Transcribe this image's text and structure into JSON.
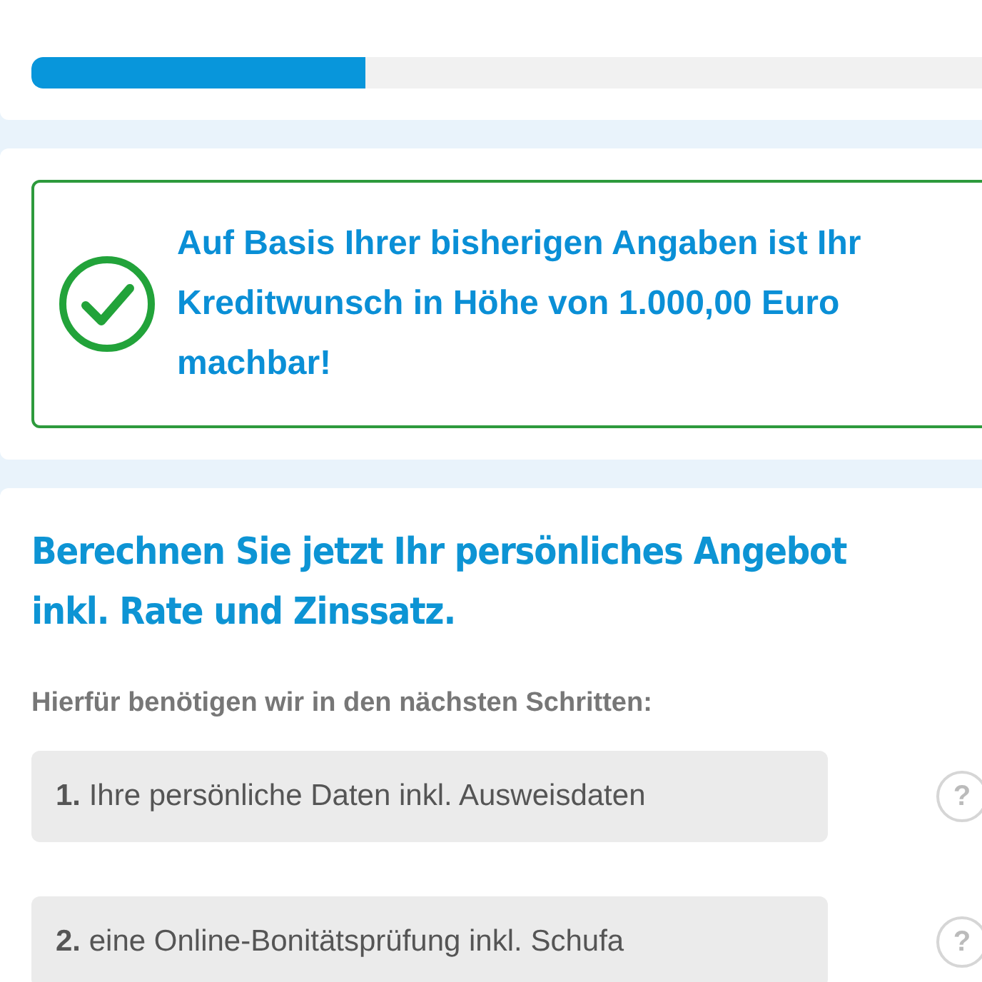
{
  "progress": {
    "level": 0.33
  },
  "result": {
    "checked": true,
    "message": "Auf Basis Ihrer bisherigen Angaben ist Ihr Kreditwunsch in Höhe von 1.000,00 Euro machbar!"
  },
  "offer": {
    "heading": "Berechnen Sie jetzt Ihr persönliches Angebot\ninkl. Rate und Zinssatz.",
    "intro": "Hierfür benötigen wir in den nächsten Schritten:",
    "steps": [
      {
        "text": "**1.** Ihre persönliche Daten inkl. Ausweisdaten",
        "help": "?"
      },
      {
        "text": "**2.** eine Online-Bonitätsprüfung inkl. Schufa",
        "help": "?"
      }
    ]
  }
}
